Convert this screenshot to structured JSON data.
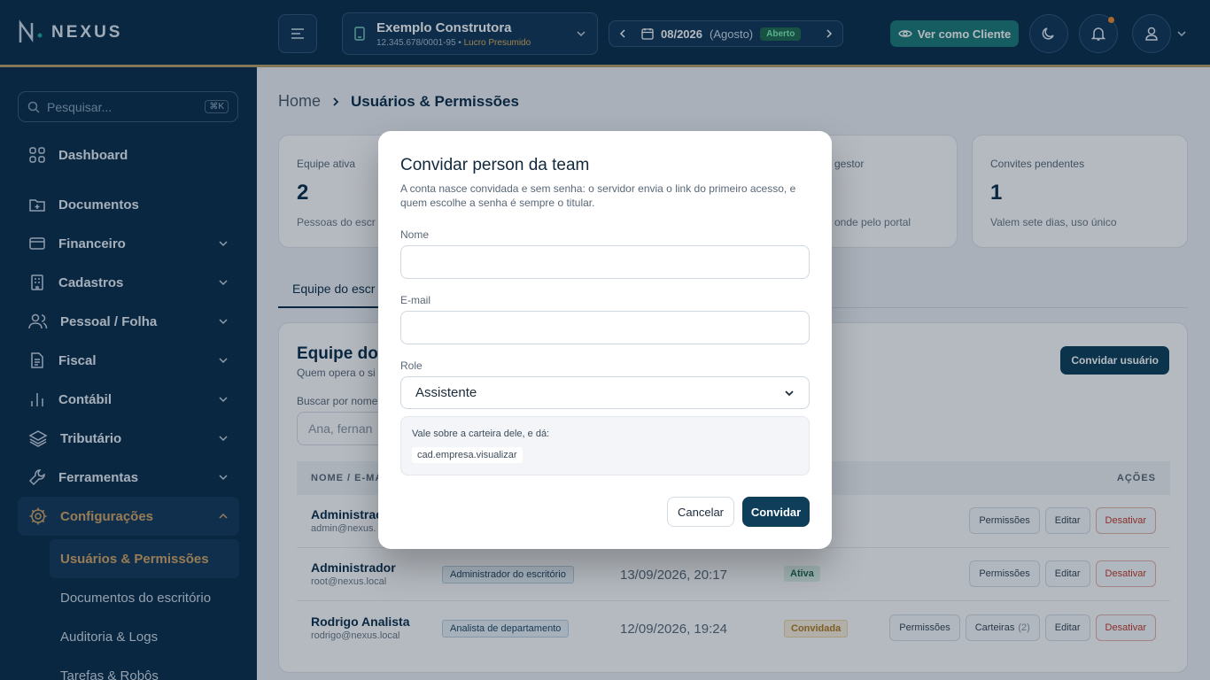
{
  "brand": {
    "name": "NEXUS"
  },
  "sidebar": {
    "search_placeholder": "Pesquisar...",
    "search_shortcut": "⌘K",
    "items": [
      {
        "label": "Dashboard",
        "icon": "grid-icon"
      },
      {
        "label": "Documentos",
        "icon": "folder-plus-icon"
      },
      {
        "label": "Financeiro",
        "icon": "wallet-icon"
      },
      {
        "label": "Cadastros",
        "icon": "building-icon"
      },
      {
        "label": "Pessoal / Folha",
        "icon": "users-icon"
      },
      {
        "label": "Fiscal",
        "icon": "document-icon"
      },
      {
        "label": "Contábil",
        "icon": "bar-chart-icon"
      },
      {
        "label": "Tributário",
        "icon": "layers-icon"
      },
      {
        "label": "Ferramentas",
        "icon": "wrench-icon"
      },
      {
        "label": "Configurações",
        "icon": "gear-icon"
      }
    ],
    "subitems": [
      "Usuários & Permissões",
      "Documentos do escritório",
      "Auditoria & Logs",
      "Tarefas & Robôs"
    ]
  },
  "header": {
    "company_name": "Exemplo Construtora",
    "company_cnpj": "12.345.678/0001-95",
    "company_regime": "Lucro Presumido",
    "period": "08/2026",
    "period_month": "(Agosto)",
    "period_status": "Aberto",
    "client_view_label": "Ver como Cliente"
  },
  "breadcrumb": {
    "home": "Home",
    "current": "Usuários & Permissões"
  },
  "stats": [
    {
      "label": "Equipe ativa",
      "value": "2",
      "desc": "Pessoas do escr"
    },
    {
      "label": "gestor",
      "value": "",
      "desc": "onde pelo portal"
    },
    {
      "label": "Convites pendentes",
      "value": "1",
      "desc": "Valem sete dias, uso único"
    }
  ],
  "tabs": {
    "active": "Equipe do escr"
  },
  "panel": {
    "title": "Equipe do",
    "subtitle": "Quem opera o si",
    "invite_label": "Convidar usuário",
    "search_label": "Buscar por nome",
    "search_placeholder": "Ana, fernan",
    "col_name": "NOME / E-MA",
    "col_actions": "AÇÕES"
  },
  "rows": [
    {
      "name": "Administrac",
      "email": "admin@nexus.",
      "role": "",
      "date": "",
      "status": "",
      "actions": [
        "Permissões",
        "Editar",
        "Desativar"
      ]
    },
    {
      "name": "Administrador",
      "email": "root@nexus.local",
      "role": "Administrador do escritório",
      "date": "13/09/2026, 20:17",
      "status": "Ativa",
      "actions": [
        "Permissões",
        "Editar",
        "Desativar"
      ]
    },
    {
      "name": "Rodrigo Analista",
      "email": "rodrigo@nexus.local",
      "role": "Analista de departamento",
      "date": "12/09/2026, 19:24",
      "status": "Convidada",
      "actions": [
        "Permissões",
        "Carteiras",
        "Editar",
        "Desativar"
      ],
      "wallet_count": "(2)"
    }
  ],
  "modal": {
    "title": "Convidar person da team",
    "description": "A conta nasce convidada e sem senha: o servidor envia o link do primeiro acesso, e quem escolhe a senha é sempre o titular.",
    "name_label": "Nome",
    "name_value": "",
    "email_label": "E-mail",
    "email_value": "",
    "role_label": "Role",
    "role_value": "Assistente",
    "info_text": "Vale sobre a carteira dele, e dá:",
    "info_permission": "cad.empresa.visualizar",
    "cancel_label": "Cancelar",
    "submit_label": "Convidar"
  },
  "colors": {
    "navy": "#0b2d4a",
    "accent": "#d6a766",
    "teal": "#1a7a78",
    "danger": "#c0392b"
  }
}
